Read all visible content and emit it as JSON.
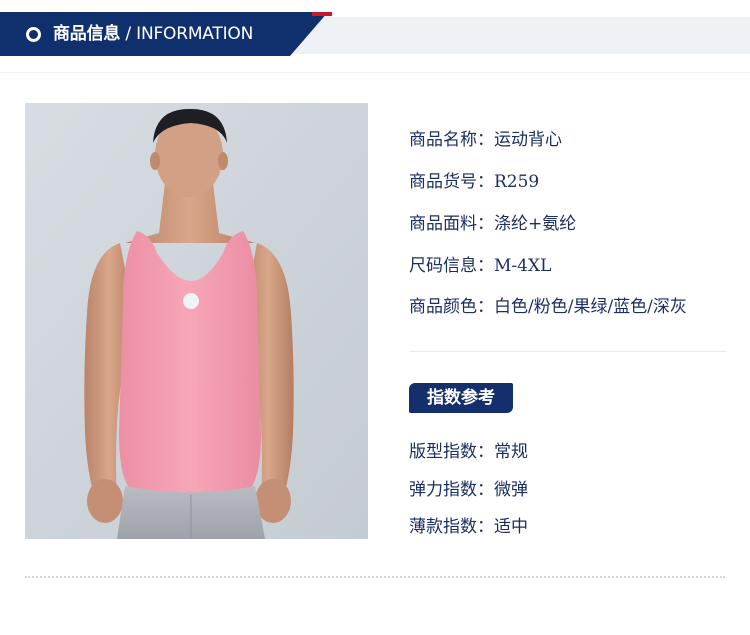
{
  "header": {
    "title_cn": "商品信息",
    "title_en": " / INFORMATION",
    "colors": {
      "banner": "#0f2f6d",
      "accent": "#c8182c",
      "band": "#eef1f5"
    }
  },
  "product_image": {
    "icon": "photo-of-model-in-pink-tank-top"
  },
  "info": [
    {
      "label": "商品名称：",
      "value": "运动背心"
    },
    {
      "label": "商品货号：",
      "value": "R259"
    },
    {
      "label": "商品面料：",
      "value": "涤纶+氨纶"
    },
    {
      "label": "尺码信息：",
      "value": "M-4XL"
    },
    {
      "label": "商品颜色：",
      "value": "白色/粉色/果绿/蓝色/深灰"
    }
  ],
  "index_badge": "指数参考",
  "index": [
    {
      "label": "版型指数：",
      "value": "常规"
    },
    {
      "label": "弹力指数：",
      "value": "微弹"
    },
    {
      "label": "薄款指数：",
      "value": "适中"
    }
  ]
}
